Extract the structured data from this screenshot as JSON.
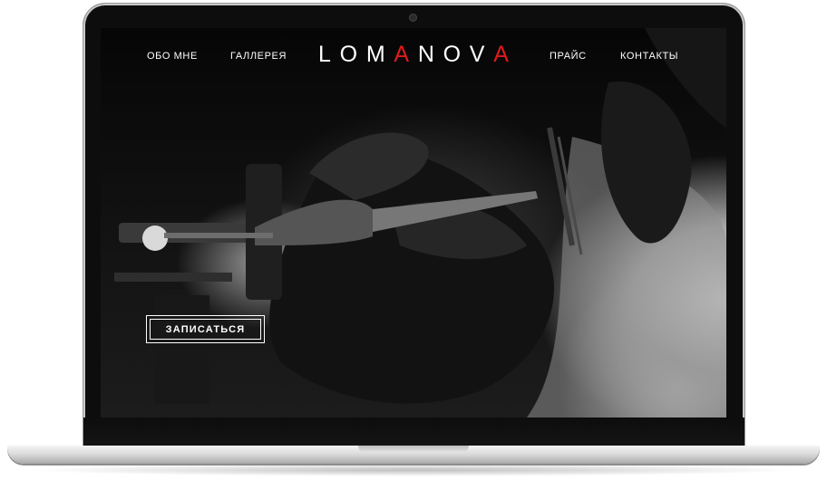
{
  "nav": {
    "left": [
      {
        "label": "ОБО МНЕ"
      },
      {
        "label": "ГАЛЛЕРЕЯ"
      }
    ],
    "right": [
      {
        "label": "ПРАЙС"
      },
      {
        "label": "КОНТАКТЫ"
      }
    ]
  },
  "logo": {
    "letters": [
      "L",
      "O",
      "M",
      "A",
      "N",
      "O",
      "V",
      "A"
    ],
    "accent_color": "#e01b1b",
    "text_color": "#ffffff"
  },
  "hero": {
    "cta_label": "ЗАПИСАТЬСЯ",
    "image_subject": "tattoo-machine-gloved-hands-photo"
  },
  "device": {
    "type": "laptop-frame"
  }
}
